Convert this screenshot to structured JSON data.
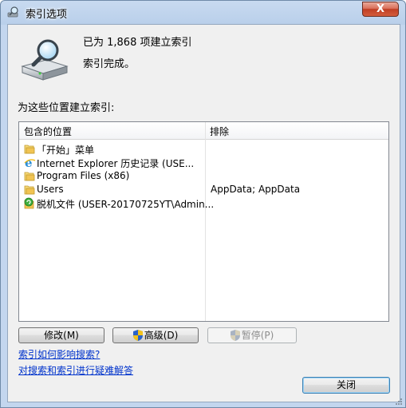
{
  "window": {
    "title": "索引选项",
    "close_label": "X"
  },
  "status": {
    "line1": "已为 1,868 项建立索引",
    "line2": "索引完成。"
  },
  "section_label": "为这些位置建立索引:",
  "list": {
    "headers": {
      "included": "包含的位置",
      "excluded": "排除"
    },
    "rows": [
      {
        "icon": "folder-icon",
        "name": "「开始」菜单",
        "exclude": ""
      },
      {
        "icon": "internet-explorer-icon",
        "name": "Internet Explorer 历史记录 (USE...",
        "exclude": ""
      },
      {
        "icon": "folder-icon",
        "name": "Program Files (x86)",
        "exclude": ""
      },
      {
        "icon": "folder-icon",
        "name": "Users",
        "exclude": "AppData; AppData"
      },
      {
        "icon": "offline-files-icon",
        "name": "脱机文件 (USER-20170725YT\\Admin...",
        "exclude": ""
      }
    ]
  },
  "buttons": {
    "modify": "修改(M)",
    "advanced": "高级(D)",
    "pause": "暂停(P)",
    "close": "关闭"
  },
  "links": {
    "how_affects": "索引如何影响搜索?",
    "troubleshoot": "对搜索和索引进行疑难解答"
  },
  "colors": {
    "link": "#0033cc",
    "close_button": "#c03e23",
    "title_bar": "#b9cfea"
  }
}
